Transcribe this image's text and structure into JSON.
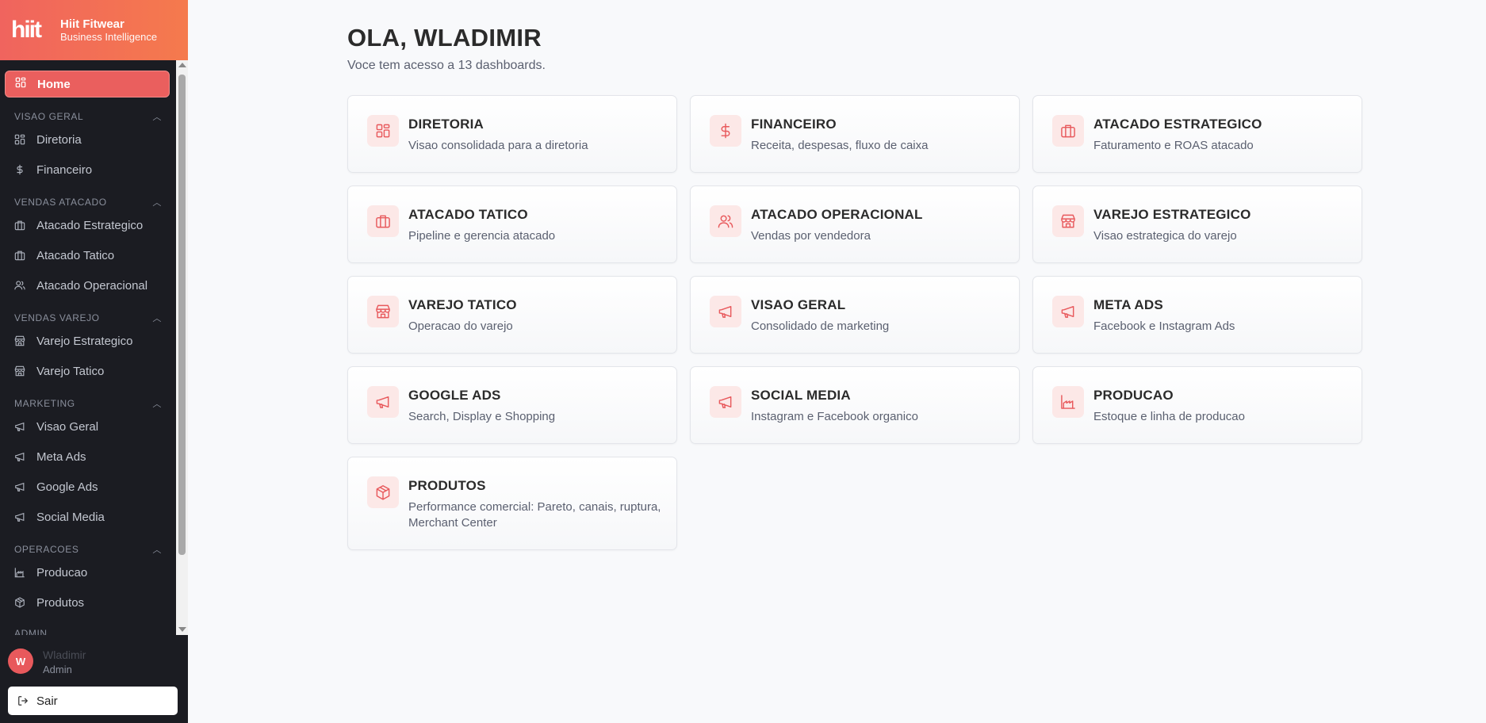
{
  "brand": {
    "logo": "hiit",
    "title": "Hiit Fitwear",
    "subtitle": "Business Intelligence"
  },
  "nav": {
    "home": "Home",
    "sections": [
      {
        "label": "VISAO GERAL",
        "items": [
          {
            "label": "Diretoria",
            "icon": "grid-icon"
          },
          {
            "label": "Financeiro",
            "icon": "dollar-icon"
          }
        ]
      },
      {
        "label": "VENDAS ATACADO",
        "items": [
          {
            "label": "Atacado Estrategico",
            "icon": "briefcase-icon"
          },
          {
            "label": "Atacado Tatico",
            "icon": "briefcase-icon"
          },
          {
            "label": "Atacado Operacional",
            "icon": "users-icon"
          }
        ]
      },
      {
        "label": "VENDAS VAREJO",
        "items": [
          {
            "label": "Varejo Estrategico",
            "icon": "store-icon"
          },
          {
            "label": "Varejo Tatico",
            "icon": "store-icon"
          }
        ]
      },
      {
        "label": "MARKETING",
        "items": [
          {
            "label": "Visao Geral",
            "icon": "megaphone-icon"
          },
          {
            "label": "Meta Ads",
            "icon": "megaphone-icon"
          },
          {
            "label": "Google Ads",
            "icon": "megaphone-icon"
          },
          {
            "label": "Social Media",
            "icon": "megaphone-icon"
          }
        ]
      },
      {
        "label": "OPERACOES",
        "items": [
          {
            "label": "Producao",
            "icon": "factory-icon"
          },
          {
            "label": "Produtos",
            "icon": "box-icon"
          }
        ]
      },
      {
        "label": "ADMIN",
        "items": []
      }
    ]
  },
  "user": {
    "initial": "W",
    "name": "Wladimir",
    "role": "Admin",
    "logout": "Sair"
  },
  "main": {
    "greeting": "OLA, WLADIMIR",
    "subtitle": "Voce tem acesso a 13 dashboards.",
    "cards": [
      {
        "title": "DIRETORIA",
        "desc": "Visao consolidada para a diretoria",
        "icon": "grid-icon"
      },
      {
        "title": "FINANCEIRO",
        "desc": "Receita, despesas, fluxo de caixa",
        "icon": "dollar-icon"
      },
      {
        "title": "ATACADO ESTRATEGICO",
        "desc": "Faturamento e ROAS atacado",
        "icon": "briefcase-icon"
      },
      {
        "title": "ATACADO TATICO",
        "desc": "Pipeline e gerencia atacado",
        "icon": "briefcase-icon"
      },
      {
        "title": "ATACADO OPERACIONAL",
        "desc": "Vendas por vendedora",
        "icon": "users-icon"
      },
      {
        "title": "VAREJO ESTRATEGICO",
        "desc": "Visao estrategica do varejo",
        "icon": "store-icon"
      },
      {
        "title": "VAREJO TATICO",
        "desc": "Operacao do varejo",
        "icon": "store-icon"
      },
      {
        "title": "VISAO GERAL",
        "desc": "Consolidado de marketing",
        "icon": "megaphone-icon"
      },
      {
        "title": "META ADS",
        "desc": "Facebook e Instagram Ads",
        "icon": "megaphone-icon"
      },
      {
        "title": "GOOGLE ADS",
        "desc": "Search, Display e Shopping",
        "icon": "megaphone-icon"
      },
      {
        "title": "SOCIAL MEDIA",
        "desc": "Instagram e Facebook organico",
        "icon": "megaphone-icon"
      },
      {
        "title": "PRODUCAO",
        "desc": "Estoque e linha de producao",
        "icon": "factory-icon"
      },
      {
        "title": "PRODUTOS",
        "desc": "Performance comercial: Pareto, canais, ruptura, Merchant Center",
        "icon": "box-icon"
      }
    ]
  },
  "colors": {
    "accent": "#ea5f5e",
    "sidebar": "#1b1c22",
    "icon_bg": "#fce8e7"
  }
}
